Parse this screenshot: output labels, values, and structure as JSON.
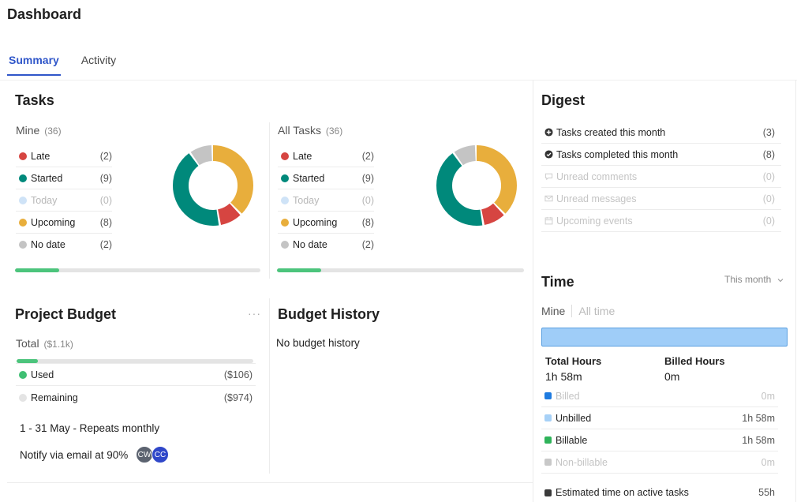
{
  "page": {
    "title": "Dashboard"
  },
  "tabs": [
    {
      "label": "Summary",
      "active": true
    },
    {
      "label": "Activity",
      "active": false
    }
  ],
  "tasks": {
    "title": "Tasks",
    "mine": {
      "label": "Mine",
      "count": "(36)",
      "progress": 0.18,
      "rows": [
        {
          "label": "Late",
          "value": "(2)",
          "color": "#d64541",
          "muted": false
        },
        {
          "label": "Started",
          "value": "(9)",
          "color": "#00897b",
          "muted": false
        },
        {
          "label": "Today",
          "value": "(0)",
          "color": "#cfe3f7",
          "muted": true
        },
        {
          "label": "Upcoming",
          "value": "(8)",
          "color": "#e8ae3c",
          "muted": false
        },
        {
          "label": "No date",
          "value": "(2)",
          "color": "#c4c4c4",
          "muted": false
        }
      ]
    },
    "all": {
      "label": "All Tasks",
      "count": "(36)",
      "progress": 0.18,
      "rows": [
        {
          "label": "Late",
          "value": "(2)",
          "color": "#d64541",
          "muted": false
        },
        {
          "label": "Started",
          "value": "(9)",
          "color": "#00897b",
          "muted": false
        },
        {
          "label": "Today",
          "value": "(0)",
          "color": "#cfe3f7",
          "muted": true
        },
        {
          "label": "Upcoming",
          "value": "(8)",
          "color": "#e8ae3c",
          "muted": false
        },
        {
          "label": "No date",
          "value": "(2)",
          "color": "#c4c4c4",
          "muted": false
        }
      ]
    }
  },
  "digest": {
    "title": "Digest",
    "rows": [
      {
        "label": "Tasks created this month",
        "value": "(3)",
        "icon": "plus-circle-icon",
        "muted": false
      },
      {
        "label": "Tasks completed this month",
        "value": "(8)",
        "icon": "check-circle-icon",
        "muted": false
      },
      {
        "label": "Unread comments",
        "value": "(0)",
        "icon": "comment-icon",
        "muted": true
      },
      {
        "label": "Unread messages",
        "value": "(0)",
        "icon": "envelope-icon",
        "muted": true
      },
      {
        "label": "Upcoming events",
        "value": "(0)",
        "icon": "calendar-icon",
        "muted": true
      }
    ]
  },
  "time": {
    "title": "Time",
    "period": "This month",
    "toggle": {
      "mine": "Mine",
      "all_time": "All time"
    },
    "total_hours_label": "Total Hours",
    "total_hours_value": "1h 58m",
    "billed_hours_label": "Billed Hours",
    "billed_hours_value": "0m",
    "rows": [
      {
        "label": "Billed",
        "value": "0m",
        "color": "#1e7be0",
        "muted": true
      },
      {
        "label": "Unbilled",
        "value": "1h 58m",
        "color": "#a7d1f7",
        "muted": false
      },
      {
        "label": "Billable",
        "value": "1h 58m",
        "color": "#2fb35a",
        "muted": false
      },
      {
        "label": "Non-billable",
        "value": "0m",
        "color": "#c8c8c8",
        "muted": true
      },
      {
        "label": "Estimated time on active tasks",
        "value": "55h",
        "color": "#3a3a3a",
        "muted": false
      }
    ]
  },
  "budget": {
    "title": "Project Budget",
    "total_label": "Total",
    "total_value": "($1.1k)",
    "progress": 0.09,
    "rows": [
      {
        "label": "Used",
        "value": "($106)",
        "color": "#3fbf73"
      },
      {
        "label": "Remaining",
        "value": "($974)",
        "color": "#e4e4e4"
      }
    ],
    "schedule": "1 - 31 May - Repeats monthly",
    "notify": "Notify via email at 90%",
    "avatars": [
      {
        "initials": "CW",
        "color": "#5c6370"
      },
      {
        "initials": "CC",
        "color": "#2f47c9"
      }
    ]
  },
  "budget_history": {
    "title": "Budget History",
    "empty": "No budget history"
  }
}
